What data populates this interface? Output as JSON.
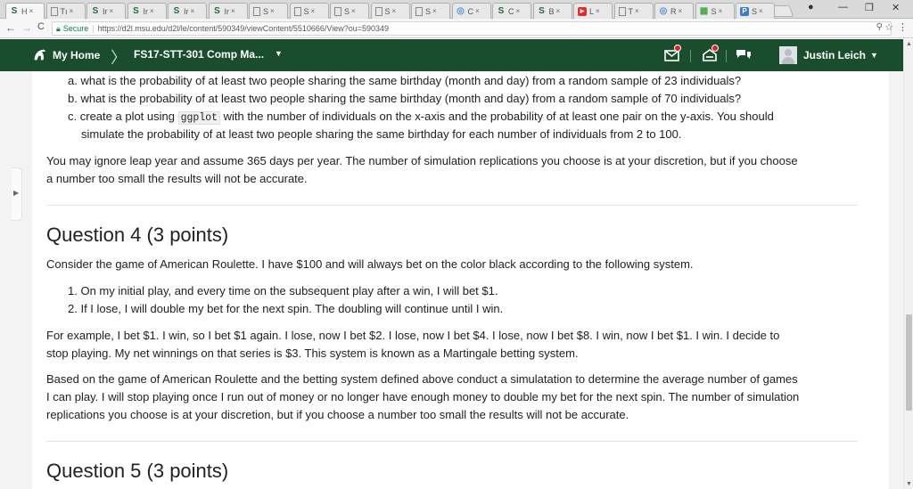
{
  "browser": {
    "tabs": [
      {
        "icon": "schoology-icon",
        "glyph": "S",
        "label": "H",
        "active": true
      },
      {
        "icon": "document-icon",
        "glyph": "",
        "label": "Tı"
      },
      {
        "icon": "schoology-icon",
        "glyph": "S",
        "label": "Ir"
      },
      {
        "icon": "schoology-icon",
        "glyph": "S",
        "label": "Ir"
      },
      {
        "icon": "schoology-icon",
        "glyph": "S",
        "label": "Ir"
      },
      {
        "icon": "schoology-icon",
        "glyph": "S",
        "label": "Ir"
      },
      {
        "icon": "document-icon",
        "glyph": "",
        "label": "S"
      },
      {
        "icon": "document-icon",
        "glyph": "",
        "label": "S"
      },
      {
        "icon": "document-icon",
        "glyph": "",
        "label": "S"
      },
      {
        "icon": "document-icon",
        "glyph": "",
        "label": "S"
      },
      {
        "icon": "document-icon",
        "glyph": "",
        "label": "S"
      },
      {
        "icon": "chrome-icon",
        "glyph": "◎",
        "label": "C"
      },
      {
        "icon": "schoology-icon",
        "glyph": "S",
        "label": "C"
      },
      {
        "icon": "schoology-icon",
        "glyph": "S",
        "label": "B"
      },
      {
        "icon": "youtube-icon",
        "glyph": "▶",
        "label": "L"
      },
      {
        "icon": "document-icon",
        "glyph": "",
        "label": "T"
      },
      {
        "icon": "chrome-icon",
        "glyph": "◎",
        "label": "R"
      },
      {
        "icon": "grid-icon",
        "glyph": "▦",
        "label": "S"
      },
      {
        "icon": "p-icon",
        "glyph": "P",
        "label": "S"
      }
    ],
    "tab_close": "×",
    "window_minimize": "—",
    "window_restore": "❐",
    "window_close": "✕",
    "back": "←",
    "forward": "→",
    "reload": "C",
    "secure_label": "Secure",
    "url": "https://d2l.msu.edu/d2l/le/content/590349/viewContent/5510666/View?ou=590349"
  },
  "nav": {
    "home_label": "My Home",
    "breadcrumb_arrow": "〉",
    "course_label": "FS17-STT-301 Comp Ma...",
    "caret": "▼",
    "user_name": "Justin Leich"
  },
  "content": {
    "items_top": [
      {
        "marker": "a.",
        "text": "what is the probability of at least two people sharing the same birthday (month and day) from a random sample of 23 individuals?"
      },
      {
        "marker": "b.",
        "text": "what is the probability of at least two people sharing the same birthday (month and day) from a random sample of 70 individuals?"
      },
      {
        "marker": "c.",
        "text_before": "create a plot using",
        "code": "ggplot",
        "text_after": "with the number of individuals on the x-axis and the probability of at least one pair on the y-axis. You should",
        "text_cont": "simulate the probability of at least two people sharing the same birthday for each number of individuals from 2 to 100."
      }
    ],
    "note_line1": "You may ignore leap year and assume 365 days per year. The number of simulation replications you choose is at your discretion, but if you choose",
    "note_line2": "a number too small the results will not be accurate.",
    "q4_title": "Question 4 (3 points)",
    "q4_intro": "Consider the game of American Roulette. I have $100 and will always bet on the color black according to the following system.",
    "q4_items": [
      {
        "marker": "1.",
        "text": "On my initial play, and every time on the subsequent play after a win, I will bet $1."
      },
      {
        "marker": "2.",
        "text": "If I lose, I will double my bet for the next spin. The doubling will continue until I win."
      }
    ],
    "q4_example_line1": "For example, I bet $1. I win, so I bet $1 again. I lose, now I bet $2. I lose, now I bet $4. I lose, now I bet $8. I win, now I bet $1. I win. I decide to",
    "q4_example_line2": "stop playing. My net winnings on that series is $3. This system is known as a Martingale betting system.",
    "q4_task_line1": "Based on the game of American Roulette and the betting system defined above conduct a simulatation to determine the average number of games",
    "q4_task_line2": "I can play. I will stop playing once I run out of money or no longer have enough money to double my bet for the next spin. The number of simulation",
    "q4_task_line3": "replications you choose is at your discretion, but if you choose a number too small the results will not be accurate.",
    "q5_title": "Question 5 (3 points)"
  }
}
